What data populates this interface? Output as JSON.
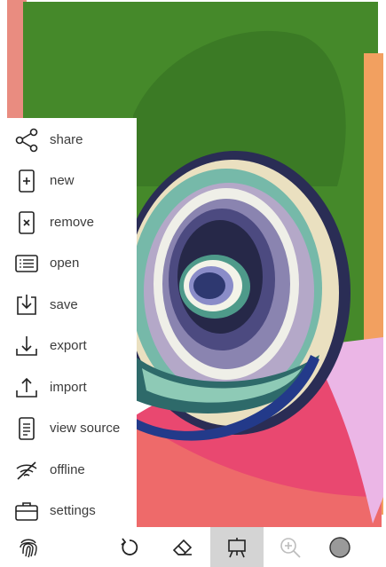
{
  "menu": {
    "items": [
      {
        "label": "share",
        "icon": "share-icon"
      },
      {
        "label": "new",
        "icon": "new-icon"
      },
      {
        "label": "remove",
        "icon": "remove-icon"
      },
      {
        "label": "open",
        "icon": "open-icon"
      },
      {
        "label": "save",
        "icon": "save-icon"
      },
      {
        "label": "export",
        "icon": "export-icon"
      },
      {
        "label": "import",
        "icon": "import-icon"
      },
      {
        "label": "view source",
        "icon": "view-source-icon"
      },
      {
        "label": "offline",
        "icon": "offline-icon"
      },
      {
        "label": "settings",
        "icon": "settings-icon"
      }
    ]
  },
  "toolbar": {
    "tools": [
      {
        "icon": "fingerprint-icon",
        "active": false
      },
      {
        "icon": "undo-icon",
        "active": false
      },
      {
        "icon": "eraser-icon",
        "active": false
      },
      {
        "icon": "easel-icon",
        "active": true
      },
      {
        "icon": "zoom-in-icon",
        "active": false,
        "disabled": true
      },
      {
        "icon": "color-swatch-icon",
        "active": false
      }
    ],
    "current_color": "#9a9a9a"
  },
  "colors": {
    "green": "#4a8a2a",
    "pink": "#ee6a86",
    "lavender": "#e8b4e8",
    "teal": "#7cc6b4",
    "navy": "#2a2a5a"
  }
}
